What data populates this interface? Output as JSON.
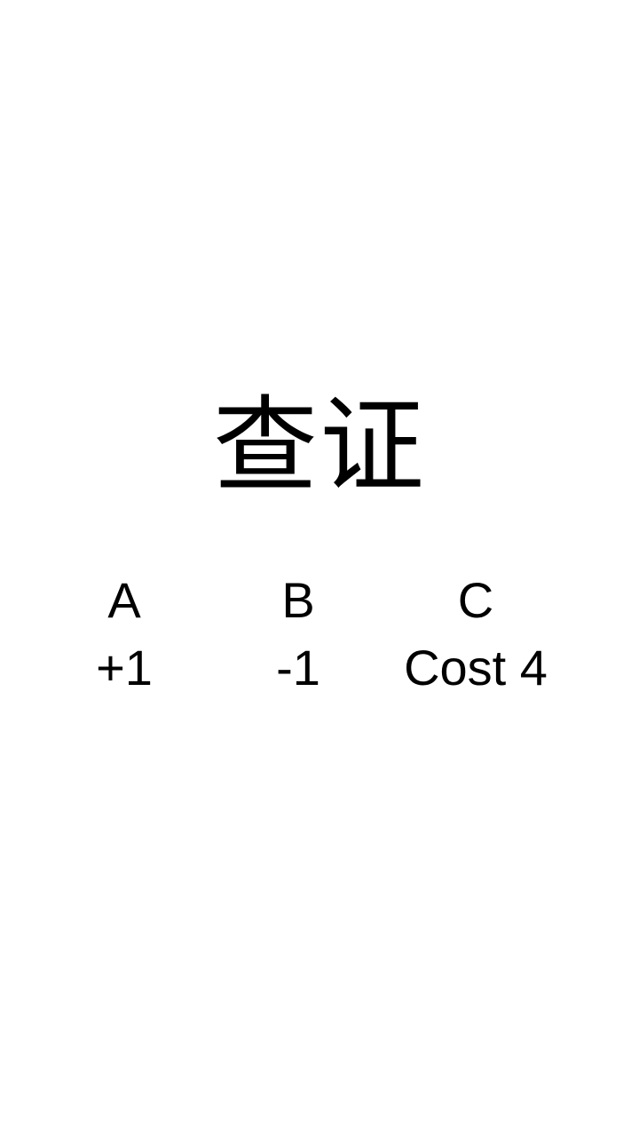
{
  "title": "查证",
  "options": [
    {
      "letter": "A",
      "effect": "+1"
    },
    {
      "letter": "B",
      "effect": "-1"
    },
    {
      "letter": "C",
      "effect": "Cost 4"
    }
  ]
}
